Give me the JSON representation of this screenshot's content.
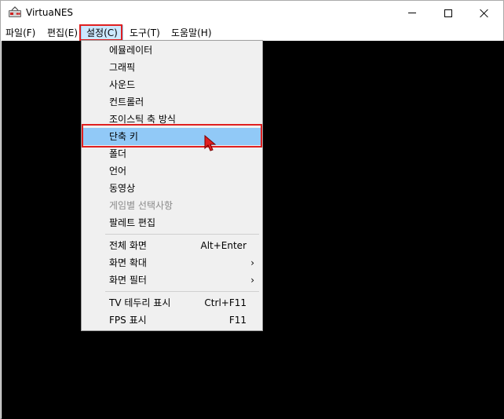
{
  "window": {
    "title": "VirtuaNES"
  },
  "menubar": {
    "items": [
      {
        "label": "파일(F)"
      },
      {
        "label": "편집(E)"
      },
      {
        "label": "설정(C)"
      },
      {
        "label": "도구(T)"
      },
      {
        "label": "도움말(H)"
      }
    ]
  },
  "dropdown": {
    "items": [
      {
        "label": "에뮬레이터"
      },
      {
        "label": "그래픽"
      },
      {
        "label": "사운드"
      },
      {
        "label": "컨트롤러"
      },
      {
        "label": "조이스틱 축 방식"
      },
      {
        "label": "단축 키"
      },
      {
        "label": "폴더"
      },
      {
        "label": "언어"
      },
      {
        "label": "동영상"
      },
      {
        "label": "게임별 선택사항"
      },
      {
        "label": "팔레트 편집"
      },
      {
        "label": "전체 화면",
        "shortcut": "Alt+Enter"
      },
      {
        "label": "화면 확대",
        "submenu": "›"
      },
      {
        "label": "화면 필터",
        "submenu": "›"
      },
      {
        "label": "TV 테두리 표시",
        "shortcut": "Ctrl+F11"
      },
      {
        "label": "FPS 표시",
        "shortcut": "F11"
      }
    ]
  },
  "colors": {
    "highlight_border": "#e02020",
    "selected_bg": "#91c9f7",
    "content_bg": "#000000"
  }
}
